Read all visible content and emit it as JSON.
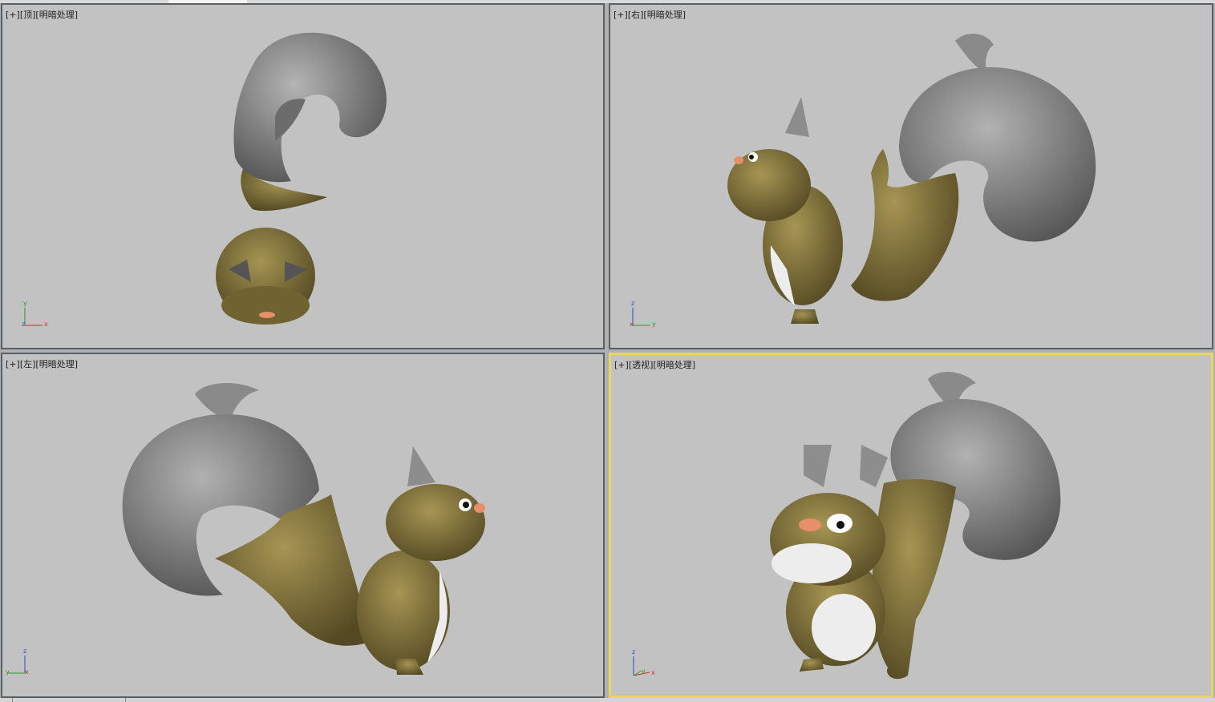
{
  "menubar": {
    "visible": true
  },
  "viewports": [
    {
      "id": "top",
      "plus": "[+]",
      "view": "顶",
      "shading": "明暗处理",
      "active": false,
      "axes": [
        "y",
        "z",
        "x"
      ]
    },
    {
      "id": "right",
      "plus": "[+]",
      "view": "右",
      "shading": "明暗处理",
      "active": false,
      "axes": [
        "z",
        "x",
        "y"
      ]
    },
    {
      "id": "left",
      "plus": "[+]",
      "view": "左",
      "shading": "明暗处理",
      "active": false,
      "axes": [
        "z",
        "y",
        "x"
      ]
    },
    {
      "id": "persp",
      "plus": "[+]",
      "view": "透视",
      "shading": "明暗处理",
      "active": true,
      "axes": [
        "z",
        "y",
        "x"
      ]
    }
  ],
  "colors": {
    "viewport_bg": "#c2c2c2",
    "body": "#857744",
    "tail": "#8e8e8e",
    "belly": "#ededed",
    "active_border": "#e8d75a",
    "axis_x": "#c83232",
    "axis_y": "#2e9a2e",
    "axis_z": "#2c4fc4"
  }
}
